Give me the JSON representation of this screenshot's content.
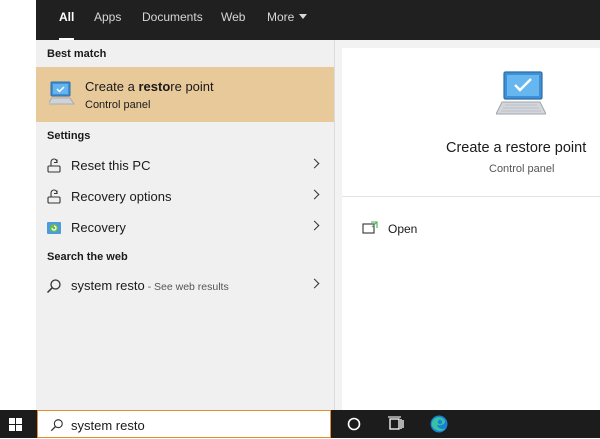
{
  "tabs": [
    {
      "label": "All",
      "active": true
    },
    {
      "label": "Apps"
    },
    {
      "label": "Documents"
    },
    {
      "label": "Web"
    },
    {
      "label": "More"
    }
  ],
  "results": {
    "best_match_header": "Best match",
    "best_match": {
      "title_before": "Create a ",
      "title_bold": "resto",
      "title_after": "re point",
      "subtitle": "Control panel"
    },
    "settings_header": "Settings",
    "settings": [
      {
        "label": "Reset this PC",
        "icon": "reset-pc-icon"
      },
      {
        "label": "Recovery options",
        "icon": "recovery-options-icon"
      },
      {
        "label": "Recovery",
        "icon": "recovery-icon"
      }
    ],
    "web_header": "Search the web",
    "web": {
      "query": "system resto",
      "hint": " - See web results"
    }
  },
  "preview": {
    "title": "Create a restore point",
    "subtitle": "Control panel",
    "open_label": "Open"
  },
  "taskbar": {
    "search_value": "system resto"
  },
  "colors": {
    "tabbar_bg": "#202020",
    "highlight": "#e8c99a",
    "panel_bg": "#f0f0f0",
    "taskbar_bg": "#1c1c1c",
    "search_border": "#e08f2a"
  }
}
